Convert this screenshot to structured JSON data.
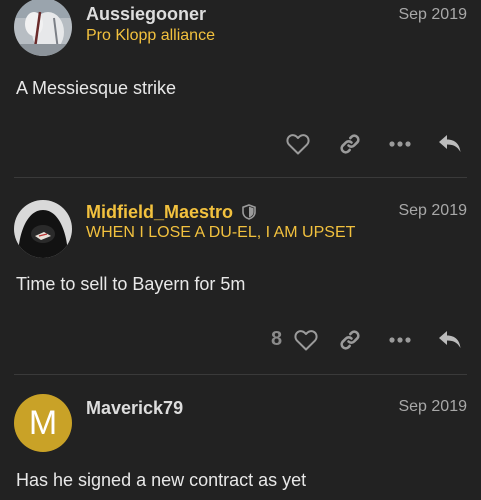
{
  "posts": [
    {
      "username": "Aussiegooner",
      "flair": "Pro Klopp alliance",
      "date": "Sep 2019",
      "body": "A Messiesque strike",
      "likes": ""
    },
    {
      "username": "Midfield_Maestro",
      "flair": "WHEN I LOSE A DU-EL, I AM UPSET",
      "date": "Sep 2019",
      "body": "Time to sell to Bayern for 5m",
      "likes": "8"
    },
    {
      "username": "Maverick79",
      "avatar_letter": "M",
      "date": "Sep 2019",
      "body": "Has he signed a new contract as yet"
    }
  ],
  "icons": {
    "like": "heart-icon",
    "link": "link-icon",
    "more": "more-icon",
    "reply": "reply-icon",
    "moderator": "shield-icon"
  },
  "colors": {
    "background": "#222222",
    "flair": "#f2c13e",
    "avatar_m": "#c9a227"
  }
}
